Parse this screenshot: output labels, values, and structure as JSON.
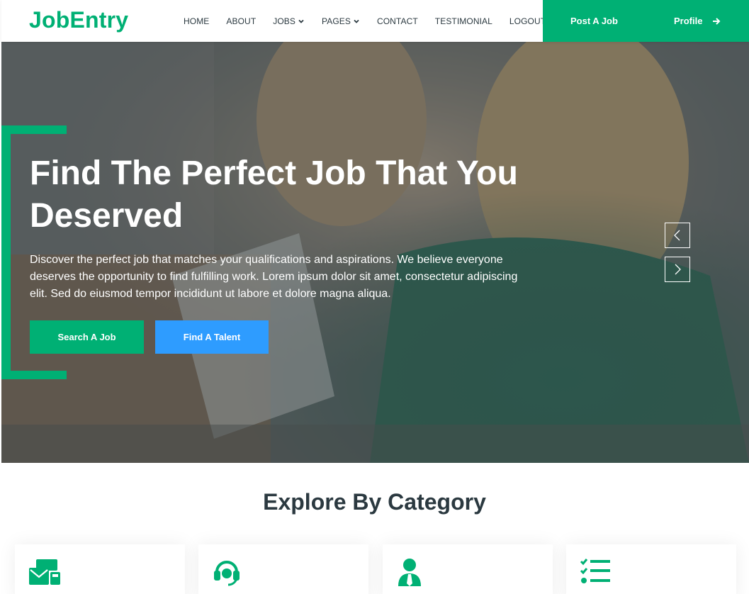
{
  "brand": "JobEntry",
  "nav": {
    "links": [
      "HOME",
      "ABOUT",
      "JOBS",
      "PAGES",
      "CONTACT",
      "TESTIMONIAL",
      "LOGOUT"
    ],
    "post_job": "Post A Job",
    "profile": "Profile"
  },
  "hero": {
    "title": "Find The Perfect Job That You Deserved",
    "description": "Discover the perfect job that matches your qualifications and aspirations. We believe everyone deserves the opportunity to find fulfilling work. Lorem ipsum dolor sit amet, consectetur adipiscing elit. Sed do eiusmod tempor incididunt ut labore et dolore magna aliqua.",
    "search_button": "Search A Job",
    "talent_button": "Find A Talent"
  },
  "categories": {
    "title": "Explore By Category",
    "cards": [
      {
        "icon": "mail-bulk-icon"
      },
      {
        "icon": "headset-icon"
      },
      {
        "icon": "user-tie-icon"
      },
      {
        "icon": "tasks-icon"
      }
    ]
  },
  "colors": {
    "primary": "#00b074",
    "secondary": "#2e9cff",
    "dark": "#2b3940"
  }
}
